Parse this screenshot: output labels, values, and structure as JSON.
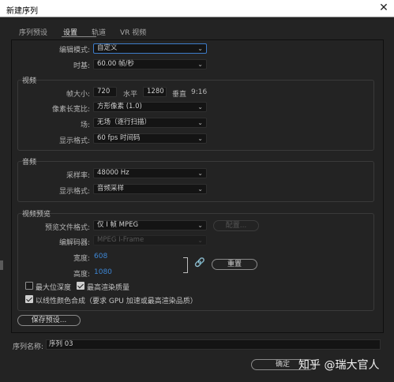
{
  "window": {
    "title": "新建序列",
    "close_glyph": "✕"
  },
  "tabs": [
    {
      "label": "序列预设"
    },
    {
      "label": "设置"
    },
    {
      "label": "轨道"
    },
    {
      "label": "VR 视频"
    }
  ],
  "general": {
    "edit_mode_label": "编辑模式:",
    "edit_mode_value": "自定义",
    "timebase_label": "时基:",
    "timebase_value": "60.00  帧/秒"
  },
  "video": {
    "section": "视频",
    "frame_size_label": "帧大小:",
    "frame_width": "720",
    "horizontal_label": "水平",
    "frame_height": "1280",
    "vertical_label": "垂直",
    "aspect": "9:16",
    "pixel_aspect_label": "像素长宽比:",
    "pixel_aspect_value": "方形像素 (1.0)",
    "fields_label": "场:",
    "fields_value": "无场（逐行扫描）",
    "display_format_label": "显示格式:",
    "display_format_value": "60 fps 时间码"
  },
  "audio": {
    "section": "音频",
    "sample_rate_label": "采样率:",
    "sample_rate_value": "48000 Hz",
    "display_format_label": "显示格式:",
    "display_format_value": "音频采样"
  },
  "preview": {
    "section": "视频预览",
    "file_format_label": "预览文件格式:",
    "file_format_value": "仅 I 帧 MPEG",
    "configure_button": "配置...",
    "codec_label": "编解码器:",
    "codec_value": "MPEG I-Frame",
    "width_label": "宽度:",
    "width_value": "608",
    "height_label": "高度:",
    "height_value": "1080",
    "reset_button": "重置",
    "link_glyph": "🔗"
  },
  "options": {
    "max_bit_depth": {
      "label": "最大位深度",
      "checked": false
    },
    "max_render_quality": {
      "label": "最高渲染质量",
      "checked": true
    },
    "linear_color": {
      "label": "以线性颜色合成（要求 GPU 加速或最高渲染品质）",
      "checked": true
    }
  },
  "save_preset_button": "保存预设...",
  "sequence_name_label": "序列名称:",
  "sequence_name_value": "序列 03",
  "ok_button": "确定",
  "watermark": "知乎 @瑞大官人"
}
